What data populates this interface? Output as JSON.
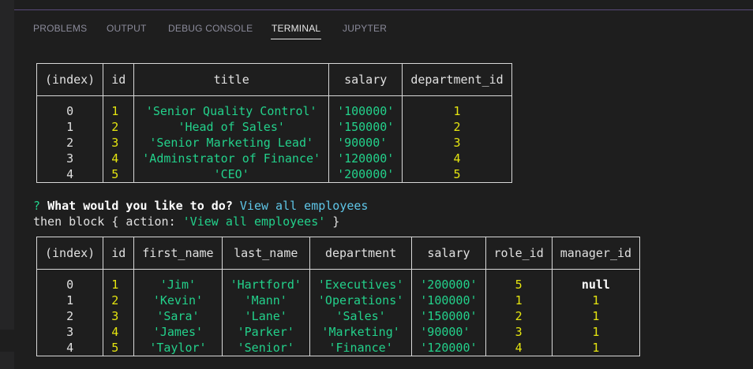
{
  "panel": {
    "tabs": [
      {
        "label": "PROBLEMS"
      },
      {
        "label": "OUTPUT"
      },
      {
        "label": "DEBUG CONSOLE"
      },
      {
        "label": "TERMINAL"
      },
      {
        "label": "JUPYTER"
      }
    ],
    "active_tab": "TERMINAL"
  },
  "roles_table": {
    "headers": [
      "(index)",
      "id",
      "title",
      "salary",
      "department_id"
    ],
    "rows": [
      {
        "index": "0",
        "id": "1",
        "title": "'Senior Quality Control'",
        "salary": "'100000'",
        "department_id": "1"
      },
      {
        "index": "1",
        "id": "2",
        "title": "'Head of Sales'",
        "salary": "'150000'",
        "department_id": "2"
      },
      {
        "index": "2",
        "id": "3",
        "title": "'Senior Marketing Lead'",
        "salary": "'90000'",
        "department_id": "3"
      },
      {
        "index": "3",
        "id": "4",
        "title": "'Adminstrator of Finance'",
        "salary": "'120000'",
        "department_id": "4"
      },
      {
        "index": "4",
        "id": "5",
        "title": "'CEO'",
        "salary": "'200000'",
        "department_id": "5"
      }
    ]
  },
  "prompt": {
    "marker": "?",
    "question": "What would you like to do?",
    "answer": "View all employees"
  },
  "log_line": {
    "prefix": "then block { action: ",
    "value": "'View all employees'",
    "suffix": " }"
  },
  "employees_table": {
    "headers": [
      "(index)",
      "id",
      "first_name",
      "last_name",
      "department",
      "salary",
      "role_id",
      "manager_id"
    ],
    "rows": [
      {
        "index": "0",
        "id": "1",
        "first_name": "'Jim'",
        "last_name": "'Hartford'",
        "department": "'Executives'",
        "salary": "'200000'",
        "role_id": "5",
        "manager_id": "null"
      },
      {
        "index": "1",
        "id": "2",
        "first_name": "'Kevin'",
        "last_name": "'Mann'",
        "department": "'Operations'",
        "salary": "'100000'",
        "role_id": "1",
        "manager_id": "1"
      },
      {
        "index": "2",
        "id": "3",
        "first_name": "'Sara'",
        "last_name": "'Lane'",
        "department": "'Sales'",
        "salary": "'150000'",
        "role_id": "2",
        "manager_id": "1"
      },
      {
        "index": "3",
        "id": "4",
        "first_name": "'James'",
        "last_name": "'Parker'",
        "department": "'Marketing'",
        "salary": "'90000'",
        "role_id": "3",
        "manager_id": "1"
      },
      {
        "index": "4",
        "id": "5",
        "first_name": "'Taylor'",
        "last_name": "'Senior'",
        "department": "'Finance'",
        "salary": "'120000'",
        "role_id": "4",
        "manager_id": "1"
      }
    ]
  }
}
